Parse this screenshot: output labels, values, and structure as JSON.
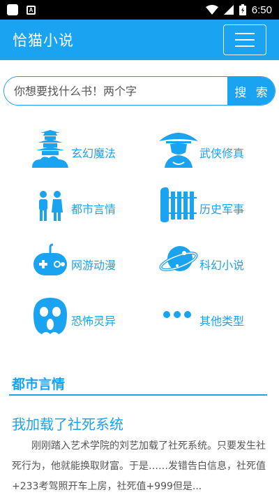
{
  "status": {
    "time": "6:50"
  },
  "app": {
    "title": "恰猫小说"
  },
  "search": {
    "placeholder": "你想要找什么书！两个字",
    "button": "搜 索"
  },
  "categories": [
    {
      "label": "玄幻魔法",
      "icon": "pagoda-icon"
    },
    {
      "label": "武侠修真",
      "icon": "swordsman-hat-icon"
    },
    {
      "label": "都市言情",
      "icon": "couple-icon"
    },
    {
      "label": "历史军事",
      "icon": "bamboo-scroll-icon"
    },
    {
      "label": "网游动漫",
      "icon": "gamepad-icon"
    },
    {
      "label": "科幻小说",
      "icon": "planet-icon"
    },
    {
      "label": "恐怖灵异",
      "icon": "scream-face-icon"
    },
    {
      "label": "其他类型",
      "icon": "dots-icon"
    }
  ],
  "section": {
    "title": "都市言情"
  },
  "book": {
    "title": "我加载了社死系统",
    "desc": "刚刚踏入艺术学院的刘艺加载了社死系统。只要发生社死行为，他就能换取财富。于是……发错告白信息，社死值+233考驾照开车上房，社死值+999但是..."
  },
  "colors": {
    "accent": "#1aa3f0",
    "statusbar": "#000000"
  }
}
